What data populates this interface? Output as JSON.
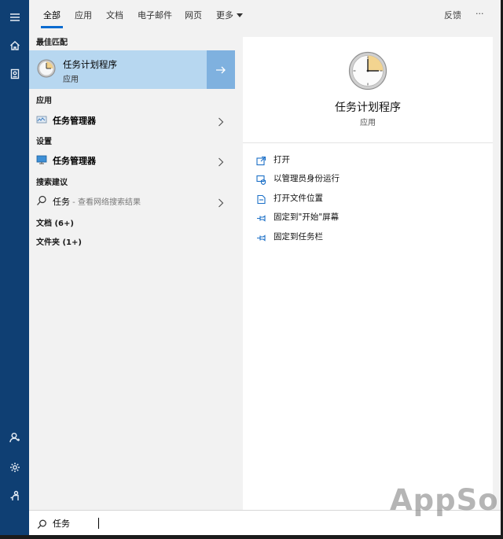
{
  "tabs": [
    {
      "label": "全部",
      "active": true
    },
    {
      "label": "应用"
    },
    {
      "label": "文档"
    },
    {
      "label": "电子邮件"
    },
    {
      "label": "网页"
    },
    {
      "label": "更多"
    }
  ],
  "topbar": {
    "feedback_label": "反馈",
    "more_options_label": "···"
  },
  "sections": {
    "best_match": "最佳匹配",
    "apps": "应用",
    "settings": "设置",
    "search_suggestions": "搜索建议"
  },
  "best_match": {
    "title": "任务计划程序",
    "subtitle": "应用"
  },
  "app_results": [
    {
      "label": "任务管理器"
    }
  ],
  "settings_results": [
    {
      "label": "任务管理器"
    }
  ],
  "suggestion": {
    "term": "任务",
    "hint": " - 查看网络搜索结果"
  },
  "counts": {
    "documents": "文档 (6+)",
    "folders": "文件夹 (1+)"
  },
  "detail": {
    "title": "任务计划程序",
    "subtitle": "应用",
    "actions": [
      {
        "label": "打开",
        "icon": "open-icon"
      },
      {
        "label": "以管理员身份运行",
        "icon": "shield-run-icon"
      },
      {
        "label": "打开文件位置",
        "icon": "file-location-icon"
      },
      {
        "label": "固定到\"开始\"屏幕",
        "icon": "pin-icon"
      },
      {
        "label": "固定到任务栏",
        "icon": "pin-icon"
      }
    ]
  },
  "search": {
    "value": "任务"
  },
  "watermark": "AppSo",
  "colors": {
    "rail": "#0f3f73",
    "accent": "#0a6bd0",
    "selected": "#b7d7f0",
    "selected_arrow": "#7fb1df"
  }
}
